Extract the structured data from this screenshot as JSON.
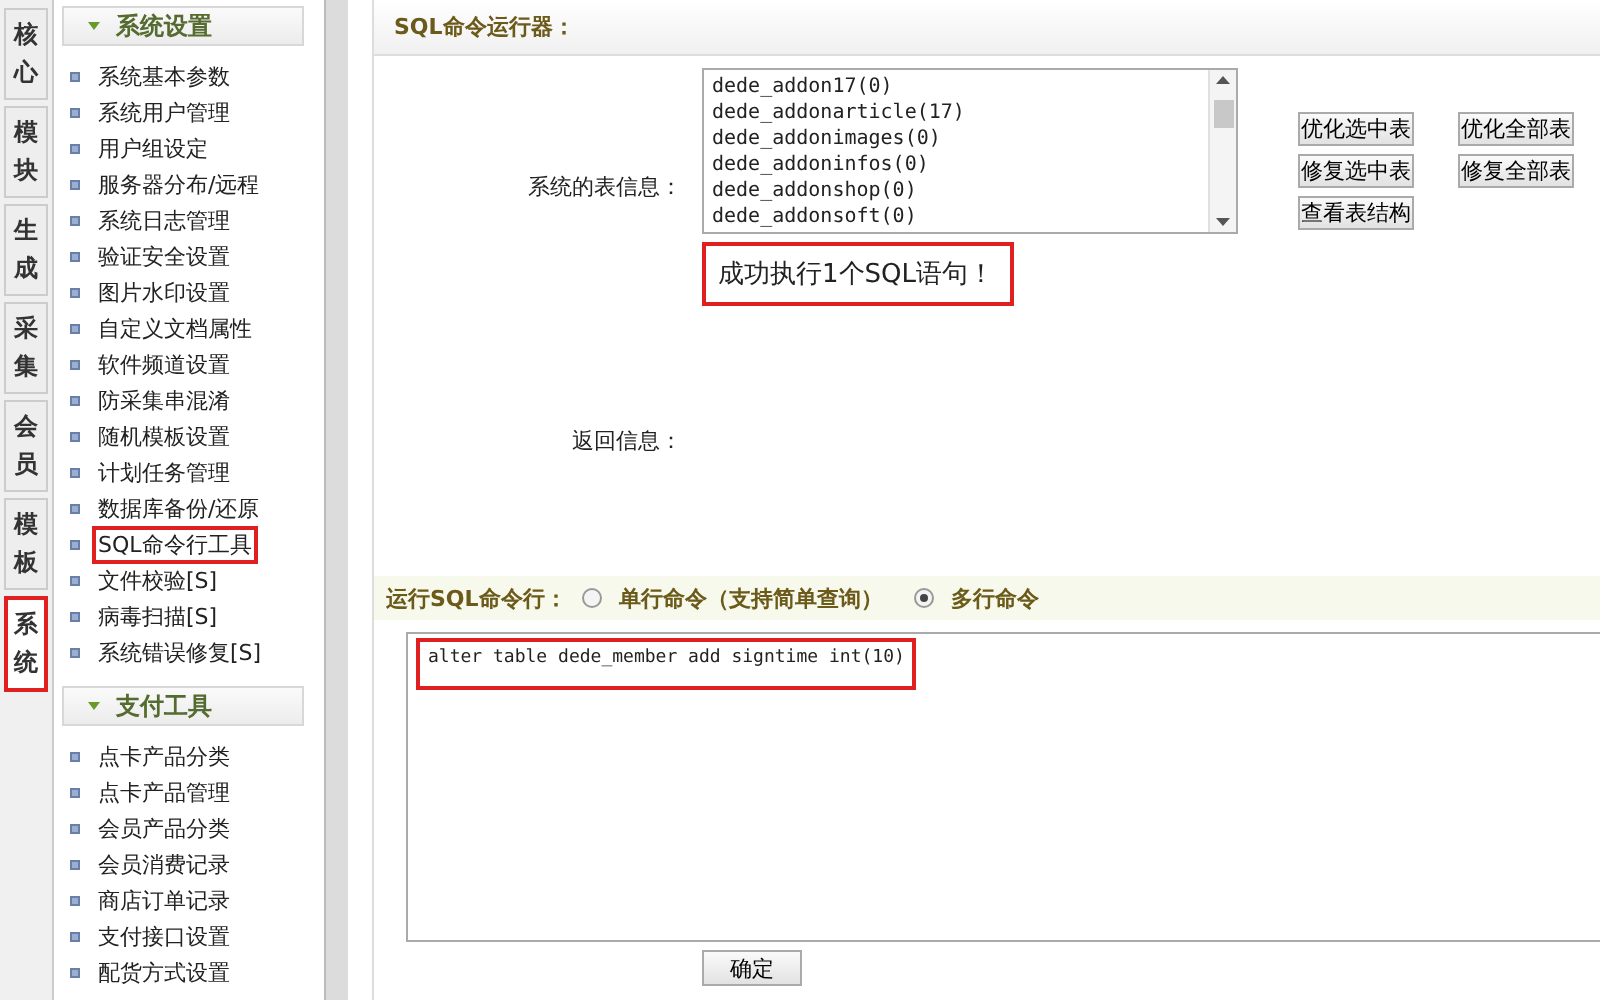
{
  "tabs": [
    {
      "label": "核心",
      "selected": false
    },
    {
      "label": "模块",
      "selected": false
    },
    {
      "label": "生成",
      "selected": false
    },
    {
      "label": "采集",
      "selected": false
    },
    {
      "label": "会员",
      "selected": false
    },
    {
      "label": "模板",
      "selected": false
    },
    {
      "label": "系统",
      "selected": true
    }
  ],
  "sidebar": {
    "sections": [
      {
        "title": "系统设置",
        "items": [
          {
            "label": "系统基本参数",
            "selected": false
          },
          {
            "label": "系统用户管理",
            "selected": false
          },
          {
            "label": "用户组设定",
            "selected": false
          },
          {
            "label": "服务器分布/远程",
            "selected": false
          },
          {
            "label": "系统日志管理",
            "selected": false
          },
          {
            "label": "验证安全设置",
            "selected": false
          },
          {
            "label": "图片水印设置",
            "selected": false
          },
          {
            "label": "自定义文档属性",
            "selected": false
          },
          {
            "label": "软件频道设置",
            "selected": false
          },
          {
            "label": "防采集串混淆",
            "selected": false
          },
          {
            "label": "随机模板设置",
            "selected": false
          },
          {
            "label": "计划任务管理",
            "selected": false
          },
          {
            "label": "数据库备份/还原",
            "selected": false
          },
          {
            "label": "SQL命令行工具",
            "selected": true
          },
          {
            "label": "文件校验[S]",
            "selected": false
          },
          {
            "label": "病毒扫描[S]",
            "selected": false
          },
          {
            "label": "系统错误修复[S]",
            "selected": false
          }
        ]
      },
      {
        "title": "支付工具",
        "items": [
          {
            "label": "点卡产品分类",
            "selected": false
          },
          {
            "label": "点卡产品管理",
            "selected": false
          },
          {
            "label": "会员产品分类",
            "selected": false
          },
          {
            "label": "会员消费记录",
            "selected": false
          },
          {
            "label": "商店订单记录",
            "selected": false
          },
          {
            "label": "支付接口设置",
            "selected": false
          },
          {
            "label": "配货方式设置",
            "selected": false
          }
        ]
      }
    ]
  },
  "panel": {
    "title": "SQL命令运行器：",
    "table_info_label": "系统的表信息：",
    "tables": [
      "dede_addon17(0)",
      "dede_addonarticle(17)",
      "dede_addonimages(0)",
      "dede_addoninfos(0)",
      "dede_addonshop(0)",
      "dede_addonsoft(0)"
    ],
    "buttons": [
      "优化选中表",
      "优化全部表",
      "修复选中表",
      "修复全部表",
      "查看表结构"
    ],
    "message": "成功执行1个SQL语句！",
    "return_label": "返回信息：",
    "mode_label": "运行SQL命令行：",
    "modes": [
      {
        "label": "单行命令（支持简单查询）",
        "selected": false
      },
      {
        "label": "多行命令",
        "selected": true
      }
    ],
    "sql": "alter table dede_member add signtime int(10)",
    "submit": "确定"
  }
}
